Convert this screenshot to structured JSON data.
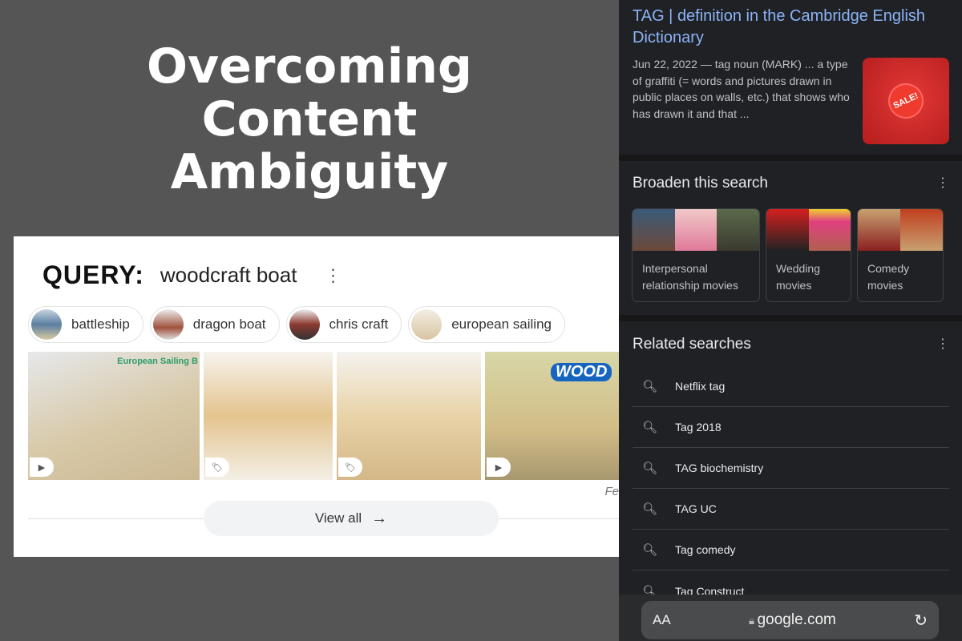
{
  "headline": [
    "Overcoming",
    "Content",
    "Ambiguity"
  ],
  "left": {
    "query_label": "QUERY:",
    "query_value": "woodcraft boat",
    "chips": [
      {
        "label": "battleship",
        "thumb": "#5a7fa0"
      },
      {
        "label": "dragon boat",
        "thumb": "#a0523e"
      },
      {
        "label": "chris craft",
        "thumb": "#8b3a2f"
      },
      {
        "label": "european sailing",
        "thumb": "#d8c4a0"
      }
    ],
    "images": [
      {
        "caption": "European Sailing B",
        "badge": "play-icon"
      },
      {
        "caption": "",
        "badge": "tag-icon"
      },
      {
        "caption": "",
        "badge": "tag-icon"
      },
      {
        "caption": "WOOD",
        "badge": "play-icon"
      }
    ],
    "truncated_text": "Fe",
    "view_all": "View all"
  },
  "right": {
    "result": {
      "title": "TAG | definition in the Cambridge English Dictionary",
      "snippet": "Jun 22, 2022 — tag noun (MARK) ... a type of graffiti (= words and pictures drawn in public places on walls, etc.) that shows who has drawn it and that ...",
      "thumb_text": "SALE!"
    },
    "broaden": {
      "title": "Broaden this search",
      "cards": [
        {
          "label": "Interpersonal relationship movies"
        },
        {
          "label": "Wedding movies"
        },
        {
          "label": "Comedy movies"
        }
      ]
    },
    "related": {
      "title": "Related searches",
      "items": [
        "Netflix tag",
        "Tag 2018",
        "TAG biochemistry",
        "TAG UC",
        "Tag comedy",
        "Tag Construct"
      ]
    },
    "browser": {
      "text_size": "AA",
      "domain": "google.com"
    }
  },
  "colors": {
    "link": "#8ab4f8",
    "dark_bg": "#202124",
    "page_bg": "#555555"
  }
}
